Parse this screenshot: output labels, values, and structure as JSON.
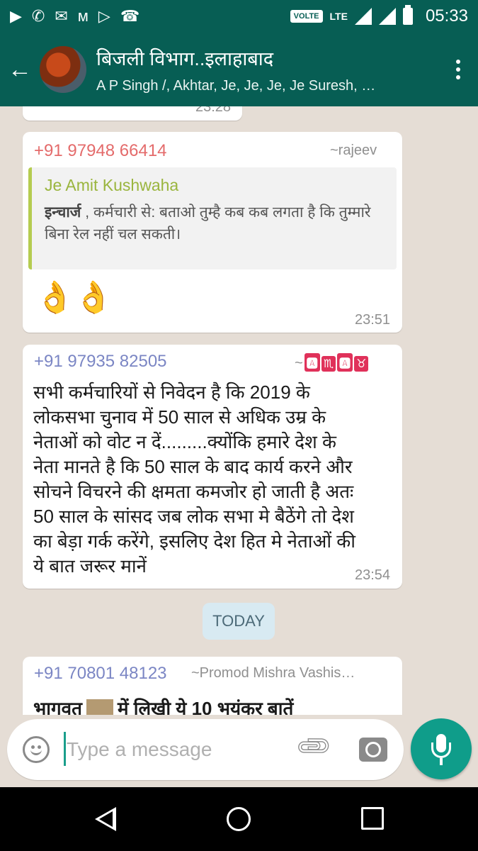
{
  "status_bar": {
    "time": "05:33",
    "volte": "VOLTE",
    "lte": "LTE"
  },
  "header": {
    "title": "बिजली विभाग..इलाहाबाद",
    "subtitle": "A P Singh /, Akhtar, Je, Je, Je, Je Suresh, …"
  },
  "messages": [
    {
      "time": "23:28"
    },
    {
      "sender": "+91 97948 66414",
      "sender_color": "#e46b6b",
      "alias": "~rajeev",
      "quote": {
        "name": "Je Amit Kushwaha",
        "bold": "इन्चार्ज",
        "text": " , कर्मचारी से: बताओ तुम्है कब कब लगता है कि तुम्मारे बिना रेल नहीं  चल सकती।"
      },
      "emoji": "👌👌",
      "time": "23:51"
    },
    {
      "sender": "+91 97935 82505",
      "sender_color": "#7b86c4",
      "alias": "~",
      "alias_badges": [
        "🅰",
        "♏",
        "🅰",
        "♉"
      ],
      "text": "सभी कर्मचारियों से निवेदन है कि 2019 के लोकसभा चुनाव में 50 साल से अधिक उम्र के नेताओं को वोट न दें.........क्योंकि हमारे देश के नेता मानते है कि 50 साल के बाद कार्य करने और सोचने विचरने की क्षमता कमजोर हो जाती है अतः 50 साल के सांसद जब लोक सभा मे बैठेंगे तो देश का बेड़ा गर्क करेंगे, इसलिए देश हित मे नेताओं की ये बात जरूर मानें",
      "time": "23:54"
    },
    {
      "sender": "+91 70801 48123",
      "sender_color": "#7b86c4",
      "alias": "~Promod Mishra Vashis…",
      "text_start": "भागवत",
      "text_end": "में लिखी ये 10 भयंकर बातें"
    }
  ],
  "date_divider": "TODAY",
  "composer": {
    "placeholder": "Type a message"
  },
  "icons": {
    "emoji": "smile-icon",
    "attach": "paperclip-icon",
    "camera": "camera-icon",
    "mic": "mic-icon"
  },
  "colors": {
    "primary": "#075e54",
    "accent": "#0f9d8a",
    "chat_bg": "#e5ddd5"
  }
}
